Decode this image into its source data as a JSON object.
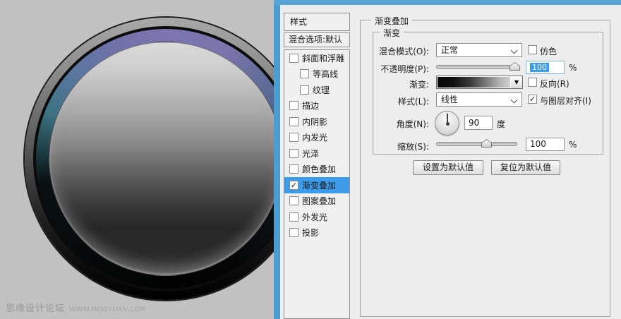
{
  "canvas": {
    "watermark_cn": "思缘设计论坛",
    "watermark_url": "www.missyuan.com"
  },
  "icons": {
    "check": "✓",
    "dropdown_arrow": "▼"
  },
  "colors": {
    "canvas_bg": "#c1c1c1",
    "dialog_bg": "#ededed",
    "titlebar_blue": "#58a4d6",
    "leftbar_blue": "#4d9dd1",
    "selection_blue": "#3d9beb",
    "bezel_purple": "#7e75b0",
    "bezel_teal": "#3d7484"
  },
  "styles_panel": {
    "header": "样式",
    "blending_options": "混合选项:默认",
    "items": [
      {
        "label": "斜面和浮雕",
        "checked": false,
        "indent": false,
        "selected": false
      },
      {
        "label": "等高线",
        "checked": false,
        "indent": true,
        "selected": false
      },
      {
        "label": "纹理",
        "checked": false,
        "indent": true,
        "selected": false
      },
      {
        "label": "描边",
        "checked": false,
        "indent": false,
        "selected": false
      },
      {
        "label": "内阴影",
        "checked": false,
        "indent": false,
        "selected": false
      },
      {
        "label": "内发光",
        "checked": false,
        "indent": false,
        "selected": false
      },
      {
        "label": "光泽",
        "checked": false,
        "indent": false,
        "selected": false
      },
      {
        "label": "颜色叠加",
        "checked": false,
        "indent": false,
        "selected": false
      },
      {
        "label": "渐变叠加",
        "checked": true,
        "indent": false,
        "selected": true
      },
      {
        "label": "图案叠加",
        "checked": false,
        "indent": false,
        "selected": false
      },
      {
        "label": "外发光",
        "checked": false,
        "indent": false,
        "selected": false
      },
      {
        "label": "投影",
        "checked": false,
        "indent": false,
        "selected": false
      }
    ]
  },
  "gradient_panel": {
    "group_title": "渐变叠加",
    "subgroup_title": "渐变",
    "blend_mode_label": "混合模式(O):",
    "blend_mode_value": "正常",
    "dither_label": "仿色",
    "opacity_label": "不透明度(P):",
    "opacity_value": "100",
    "opacity_unit": "%",
    "gradient_label": "渐变:",
    "reverse_label": "反向(R)",
    "style_label": "样式(L):",
    "style_value": "线性",
    "align_label": "与图层对齐(I)",
    "angle_label": "角度(N):",
    "angle_value": "90",
    "angle_unit": "度",
    "scale_label": "缩放(S):",
    "scale_value": "100",
    "scale_unit": "%",
    "make_default_button": "设置为默认值",
    "reset_default_button": "复位为默认值"
  }
}
